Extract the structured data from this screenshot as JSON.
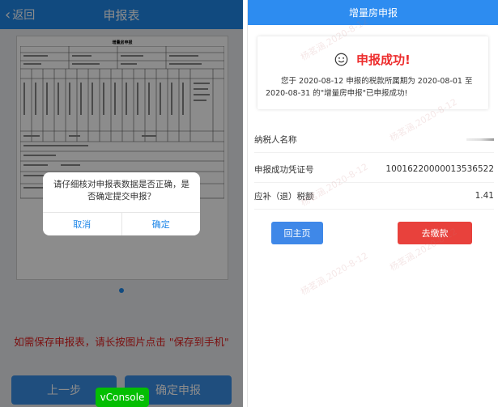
{
  "left": {
    "header": {
      "back_label": "返回",
      "title": "申报表"
    },
    "sheet_title": "增量房申报",
    "hint": "如需保存申报表，请长按图片点击 \"保存到手机\"",
    "buttons": {
      "prev": "上一步",
      "confirm": "确定申报"
    },
    "vconsole": "vConsole",
    "dialog": {
      "message": "请仔细核对申报表数据是否正确，是否确定提交申报？",
      "cancel": "取消",
      "ok": "确定"
    }
  },
  "right": {
    "header": {
      "title": "增量房申报"
    },
    "success": {
      "title": "申报成功!",
      "desc": "您于 2020-08-12 申报的税款所属期为 2020-08-01 至 2020-08-31 的\"增量房申报\"已申报成功!"
    },
    "rows": [
      {
        "label": "纳税人名称",
        "value": ""
      },
      {
        "label": "申报成功凭证号",
        "value": "10016220000013536522"
      },
      {
        "label": "应补（退）税额",
        "value": "1.41"
      }
    ],
    "buttons": {
      "home": "回主页",
      "pay": "去缴款"
    },
    "watermark": "杨茗涵,2020-8-12"
  },
  "colors": {
    "accent": "#2d8cf0",
    "danger": "#e8413c",
    "hint": "#e02020"
  }
}
